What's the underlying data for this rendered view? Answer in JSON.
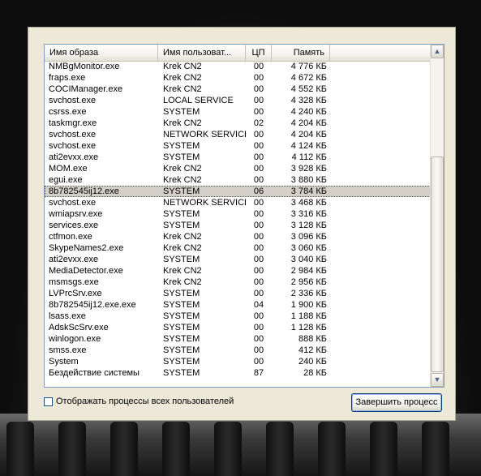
{
  "columns": {
    "name": "Имя образа",
    "user": "Имя пользоват...",
    "cpu": "ЦП",
    "memory": "Память"
  },
  "processes": [
    {
      "name": "NMBgMonitor.exe",
      "user": "Krek CN2",
      "cpu": "00",
      "memory": "4 776 КБ"
    },
    {
      "name": "fraps.exe",
      "user": "Krek CN2",
      "cpu": "00",
      "memory": "4 672 КБ"
    },
    {
      "name": "COCIManager.exe",
      "user": "Krek CN2",
      "cpu": "00",
      "memory": "4 552 КБ"
    },
    {
      "name": "svchost.exe",
      "user": "LOCAL SERVICE",
      "cpu": "00",
      "memory": "4 328 КБ"
    },
    {
      "name": "csrss.exe",
      "user": "SYSTEM",
      "cpu": "00",
      "memory": "4 240 КБ"
    },
    {
      "name": "taskmgr.exe",
      "user": "Krek CN2",
      "cpu": "02",
      "memory": "4 204 КБ"
    },
    {
      "name": "svchost.exe",
      "user": "NETWORK SERVICE",
      "cpu": "00",
      "memory": "4 204 КБ"
    },
    {
      "name": "svchost.exe",
      "user": "SYSTEM",
      "cpu": "00",
      "memory": "4 124 КБ"
    },
    {
      "name": "ati2evxx.exe",
      "user": "SYSTEM",
      "cpu": "00",
      "memory": "4 112 КБ"
    },
    {
      "name": "MOM.exe",
      "user": "Krek CN2",
      "cpu": "00",
      "memory": "3 928 КБ"
    },
    {
      "name": "egui.exe",
      "user": "Krek CN2",
      "cpu": "00",
      "memory": "3 880 КБ"
    },
    {
      "name": "8b782545ij12.exe",
      "user": "SYSTEM",
      "cpu": "06",
      "memory": "3 784 КБ",
      "selected": true
    },
    {
      "name": "svchost.exe",
      "user": "NETWORK SERVICE",
      "cpu": "00",
      "memory": "3 468 КБ"
    },
    {
      "name": "wmiapsrv.exe",
      "user": "SYSTEM",
      "cpu": "00",
      "memory": "3 316 КБ"
    },
    {
      "name": "services.exe",
      "user": "SYSTEM",
      "cpu": "00",
      "memory": "3 128 КБ"
    },
    {
      "name": "ctfmon.exe",
      "user": "Krek CN2",
      "cpu": "00",
      "memory": "3 096 КБ"
    },
    {
      "name": "SkypeNames2.exe",
      "user": "Krek CN2",
      "cpu": "00",
      "memory": "3 060 КБ"
    },
    {
      "name": "ati2evxx.exe",
      "user": "SYSTEM",
      "cpu": "00",
      "memory": "3 040 КБ"
    },
    {
      "name": "MediaDetector.exe",
      "user": "Krek CN2",
      "cpu": "00",
      "memory": "2 984 КБ"
    },
    {
      "name": "msmsgs.exe",
      "user": "Krek CN2",
      "cpu": "00",
      "memory": "2 956 КБ"
    },
    {
      "name": "LVPrcSrv.exe",
      "user": "SYSTEM",
      "cpu": "00",
      "memory": "2 336 КБ"
    },
    {
      "name": "8b782545ij12.exe.exe",
      "user": "SYSTEM",
      "cpu": "04",
      "memory": "1 900 КБ"
    },
    {
      "name": "lsass.exe",
      "user": "SYSTEM",
      "cpu": "00",
      "memory": "1 188 КБ"
    },
    {
      "name": "AdskScSrv.exe",
      "user": "SYSTEM",
      "cpu": "00",
      "memory": "1 128 КБ"
    },
    {
      "name": "winlogon.exe",
      "user": "SYSTEM",
      "cpu": "00",
      "memory": "888 КБ"
    },
    {
      "name": "smss.exe",
      "user": "SYSTEM",
      "cpu": "00",
      "memory": "412 КБ"
    },
    {
      "name": "System",
      "user": "SYSTEM",
      "cpu": "00",
      "memory": "240 КБ"
    },
    {
      "name": "Бездействие системы",
      "user": "SYSTEM",
      "cpu": "87",
      "memory": "28 КБ"
    }
  ],
  "show_all_users_label": "Отображать процессы всех пользователей",
  "end_process_label": "Завершить процесс",
  "scrollbar": {
    "up_icon": "arrow-up-icon",
    "down_icon": "arrow-down-icon",
    "position_fraction": 1.0
  },
  "colors": {
    "panel": "#ece9d8",
    "selection": "#d4d0c8",
    "border": "#7f9db9"
  }
}
